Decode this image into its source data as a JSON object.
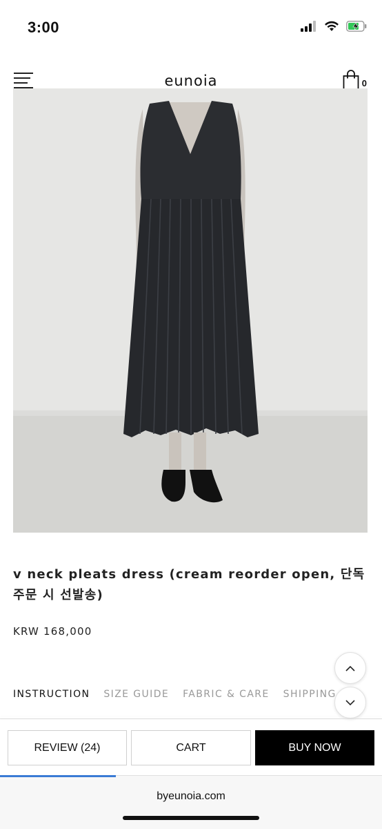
{
  "status_bar": {
    "time": "3:00",
    "icons": [
      "signal-icon",
      "wifi-icon",
      "battery-charging-icon"
    ]
  },
  "header": {
    "menu_icon": "hamburger-menu-icon",
    "brand": "eunoia",
    "cart_icon": "shopping-bag-icon",
    "cart_count": "0"
  },
  "product": {
    "image": "product-photo",
    "title": "v neck pleats dress (cream reorder open, 단독 주문 시 선발송)",
    "price": "KRW 168,000"
  },
  "tabs": [
    {
      "label": "INSTRUCTION",
      "active": true
    },
    {
      "label": "SIZE GUIDE",
      "active": false
    },
    {
      "label": "FABRIC & CARE",
      "active": false
    },
    {
      "label": "SHIPPING",
      "active": false
    }
  ],
  "scroll_buttons": {
    "up_icon": "chevron-up-icon",
    "down_icon": "chevron-down-icon"
  },
  "actions": {
    "review_label": "REVIEW (24)",
    "cart_label": "CART",
    "buy_label": "BUY NOW"
  },
  "browser": {
    "url": "byeunoia.com"
  },
  "colors": {
    "accent": "#000000",
    "progress": "#3a7bd5",
    "tab_inactive": "#999999"
  }
}
